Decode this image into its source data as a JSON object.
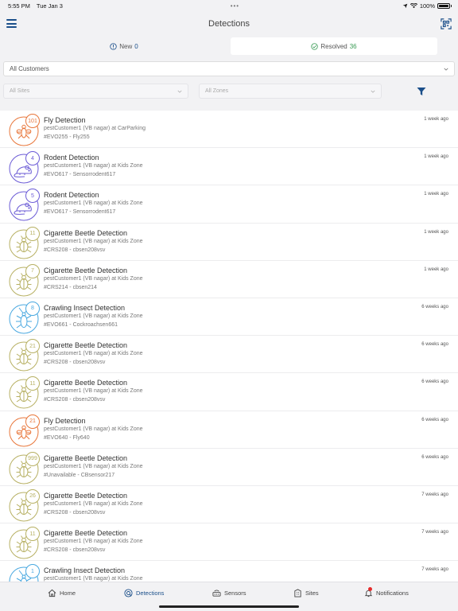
{
  "status": {
    "time": "5:55 PM",
    "date": "Tue Jan 3",
    "battery": "100%",
    "center": "•••"
  },
  "nav": {
    "title": "Detections"
  },
  "segments": {
    "new_label": "New",
    "new_count": "0",
    "resolved_label": "Resolved",
    "resolved_count": "36"
  },
  "filters": {
    "customers": "All Customers",
    "sites": "All Sites",
    "zones": "All Zones"
  },
  "colors": {
    "fly": "#e8763a",
    "rodent": "#6b5bd6",
    "beetle": "#b7b063",
    "crawling": "#49a8e0",
    "accent": "#1b4f8a"
  },
  "detections": [
    {
      "type": "fly",
      "icon": "fly-icon",
      "count": "101",
      "title": "Fly Detection",
      "subtitle": "pestCustomer1 (VB nagar) at CarParking",
      "device": "#EVO255 - Fly255",
      "time": "1 week ago"
    },
    {
      "type": "rodent",
      "icon": "rodent-icon",
      "count": "4",
      "title": "Rodent Detection",
      "subtitle": "pestCustomer1 (VB nagar) at Kids Zone",
      "device": "#EVO617 - Sensorrodent617",
      "time": "1 week ago"
    },
    {
      "type": "rodent",
      "icon": "rodent-icon",
      "count": "5",
      "title": "Rodent Detection",
      "subtitle": "pestCustomer1 (VB nagar) at Kids Zone",
      "device": "#EVO617 - Sensorrodent617",
      "time": "1 week ago"
    },
    {
      "type": "beetle",
      "icon": "beetle-icon",
      "count": "11",
      "title": "Cigarette Beetle Detection",
      "subtitle": "pestCustomer1 (VB nagar) at Kids Zone",
      "device": "#CRS208 - cbsen208vsv",
      "time": "1 week ago"
    },
    {
      "type": "beetle",
      "icon": "beetle-icon",
      "count": "7",
      "title": "Cigarette Beetle Detection",
      "subtitle": "pestCustomer1 (VB nagar) at Kids Zone",
      "device": "#CRS214 - cbsen214",
      "time": "1 week ago"
    },
    {
      "type": "crawling",
      "icon": "cockroach-icon",
      "count": "8",
      "title": "Crawling Insect Detection",
      "subtitle": "pestCustomer1 (VB nagar) at Kids Zone",
      "device": "#EVO661 - Cockroachsen661",
      "time": "6  weeks ago"
    },
    {
      "type": "beetle",
      "icon": "beetle-icon",
      "count": "21",
      "title": "Cigarette Beetle Detection",
      "subtitle": "pestCustomer1 (VB nagar) at Kids Zone",
      "device": "#CRS208 - cbsen208vsv",
      "time": "6  weeks ago"
    },
    {
      "type": "beetle",
      "icon": "beetle-icon",
      "count": "11",
      "title": "Cigarette Beetle Detection",
      "subtitle": "pestCustomer1 (VB nagar) at Kids Zone",
      "device": "#CRS208 - cbsen208vsv",
      "time": "6  weeks ago"
    },
    {
      "type": "fly",
      "icon": "fly-icon",
      "count": "21",
      "title": "Fly Detection",
      "subtitle": "pestCustomer1 (VB nagar) at Kids Zone",
      "device": "#EVO640 - Fly640",
      "time": "6  weeks ago"
    },
    {
      "type": "beetle",
      "icon": "beetle-icon",
      "count": "999",
      "title": "Cigarette Beetle Detection",
      "subtitle": "pestCustomer1 (VB nagar) at Kids Zone",
      "device": "#Unavailable - CBsensor217",
      "time": "6  weeks ago"
    },
    {
      "type": "beetle",
      "icon": "beetle-icon",
      "count": "26",
      "title": "Cigarette Beetle Detection",
      "subtitle": "pestCustomer1 (VB nagar) at Kids Zone",
      "device": "#CRS208 - cbsen208vsv",
      "time": "7  weeks ago"
    },
    {
      "type": "beetle",
      "icon": "beetle-icon",
      "count": "11",
      "title": "Cigarette Beetle Detection",
      "subtitle": "pestCustomer1 (VB nagar) at Kids Zone",
      "device": "#CRS208 - cbsen208vsv",
      "time": "7  weeks ago"
    },
    {
      "type": "crawling",
      "icon": "cockroach-icon",
      "count": "1",
      "title": "Crawling Insect Detection",
      "subtitle": "pestCustomer1 (VB nagar) at Kids Zone",
      "device": "",
      "time": "7  weeks ago"
    }
  ],
  "tabs": {
    "home": "Home",
    "detections": "Detections",
    "sensors": "Sensors",
    "sites": "Sites",
    "notifications": "Notifications"
  }
}
